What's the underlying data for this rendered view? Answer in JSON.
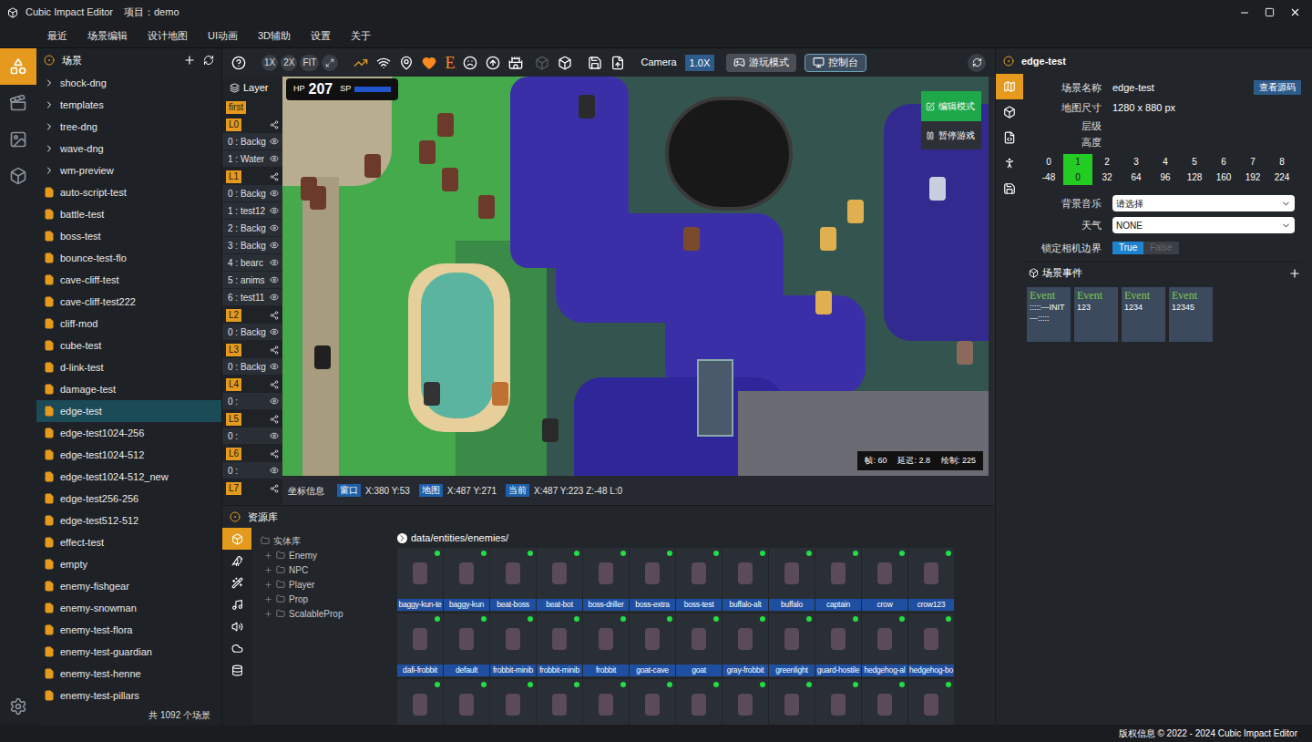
{
  "window": {
    "title": "Cubic Impact Editor",
    "project": "项目：demo"
  },
  "menu": [
    "最近",
    "场景编辑",
    "设计地图",
    "UI动画",
    "3D辅助",
    "设置",
    "关于"
  ],
  "rail": [
    {
      "selected": true
    },
    {
      "selected": false
    },
    {
      "selected": false
    },
    {
      "selected": false
    }
  ],
  "scenes": {
    "title": "场景",
    "footer": "共 1092 个场景",
    "items": [
      {
        "name": "shock-dng",
        "kind": "folder",
        "selected": false
      },
      {
        "name": "templates",
        "kind": "folder",
        "selected": false
      },
      {
        "name": "tree-dng",
        "kind": "folder",
        "selected": false
      },
      {
        "name": "wave-dng",
        "kind": "folder",
        "selected": false
      },
      {
        "name": "wm-preview",
        "kind": "folder",
        "selected": false
      },
      {
        "name": "auto-script-test",
        "kind": "file",
        "selected": false
      },
      {
        "name": "battle-test",
        "kind": "file",
        "selected": false
      },
      {
        "name": "boss-test",
        "kind": "file",
        "selected": false
      },
      {
        "name": "bounce-test-flo",
        "kind": "file",
        "selected": false
      },
      {
        "name": "cave-cliff-test",
        "kind": "file",
        "selected": false
      },
      {
        "name": "cave-cliff-test222",
        "kind": "file",
        "selected": false
      },
      {
        "name": "cliff-mod",
        "kind": "file",
        "selected": false
      },
      {
        "name": "cube-test",
        "kind": "file",
        "selected": false
      },
      {
        "name": "d-link-test",
        "kind": "file",
        "selected": false
      },
      {
        "name": "damage-test",
        "kind": "file",
        "selected": false
      },
      {
        "name": "edge-test",
        "kind": "file",
        "selected": true
      },
      {
        "name": "edge-test1024-256",
        "kind": "file",
        "selected": false
      },
      {
        "name": "edge-test1024-512",
        "kind": "file",
        "selected": false
      },
      {
        "name": "edge-test1024-512_new",
        "kind": "file",
        "selected": false
      },
      {
        "name": "edge-test256-256",
        "kind": "file",
        "selected": false
      },
      {
        "name": "edge-test512-512",
        "kind": "file",
        "selected": false
      },
      {
        "name": "effect-test",
        "kind": "file",
        "selected": false
      },
      {
        "name": "empty",
        "kind": "file",
        "selected": false
      },
      {
        "name": "enemy-fishgear",
        "kind": "file",
        "selected": false
      },
      {
        "name": "enemy-snowman",
        "kind": "file",
        "selected": false
      },
      {
        "name": "enemy-test-flora",
        "kind": "file",
        "selected": false
      },
      {
        "name": "enemy-test-guardian",
        "kind": "file",
        "selected": false
      },
      {
        "name": "enemy-test-henne",
        "kind": "file",
        "selected": false
      },
      {
        "name": "enemy-test-pillars",
        "kind": "file",
        "selected": false
      }
    ]
  },
  "toolbar": {
    "zoom": [
      "1X",
      "2X",
      "FIT"
    ],
    "e_label": "E",
    "camera_label": "Camera",
    "camera_value": "1.0X",
    "play_mode": "游玩模式",
    "console": "控制台"
  },
  "layers": {
    "title": "Layer",
    "groups": [
      {
        "label": "first",
        "kind": "marker",
        "rows": []
      },
      {
        "label": "L0",
        "kind": "layer",
        "rows": [
          "0 : Backg",
          "1 : Water"
        ]
      },
      {
        "label": "L1",
        "kind": "layer",
        "rows": [
          "0 : Backg",
          "1 : test12",
          "2 : Backg",
          "3 : Backg",
          "4 : bearc",
          "5 : anims",
          "6 : test11"
        ]
      },
      {
        "label": "L2",
        "kind": "layer",
        "rows": [
          "0 : Backg"
        ]
      },
      {
        "label": "L3",
        "kind": "layer",
        "rows": [
          "0 : Backg"
        ]
      },
      {
        "label": "L4",
        "kind": "layer",
        "rows": [
          "0 : "
        ]
      },
      {
        "label": "L5",
        "kind": "layer",
        "rows": [
          "0 : "
        ]
      },
      {
        "label": "L6",
        "kind": "layer",
        "rows": [
          "0 : "
        ]
      },
      {
        "label": "L7",
        "kind": "layer",
        "rows": []
      }
    ]
  },
  "game": {
    "hp_label": "HP",
    "hp": "207",
    "sp_label": "SP",
    "edit_mode": "编辑模式",
    "pause": "暂停游戏",
    "stats": [
      "帧: 60",
      "延迟: 2.8",
      "绘制: 225"
    ]
  },
  "coords": {
    "title": "坐标信息",
    "items": [
      {
        "tag": "窗口",
        "value": "X:380 Y:53"
      },
      {
        "tag": "地图",
        "value": "X:487 Y:271"
      },
      {
        "tag": "当前",
        "value": "X:487 Y:223 Z:-48 L:0"
      }
    ]
  },
  "resources": {
    "title": "资源库",
    "tabs": [
      {
        "selected": true
      },
      {
        "selected": false
      },
      {
        "selected": false
      },
      {
        "selected": false
      },
      {
        "selected": false
      },
      {
        "selected": false
      },
      {
        "selected": false
      }
    ],
    "tree": {
      "root": "实体库",
      "children": [
        "Enemy",
        "NPC",
        "Player",
        "Prop",
        "ScalableProp"
      ]
    },
    "path": "data/entities/enemies/",
    "entities": [
      {
        "name": "baggy-kun-te"
      },
      {
        "name": "baggy-kun"
      },
      {
        "name": "beat-boss"
      },
      {
        "name": "beat-bot"
      },
      {
        "name": "boss-driller"
      },
      {
        "name": "boss-extra"
      },
      {
        "name": "boss-test"
      },
      {
        "name": "buffalo-alt"
      },
      {
        "name": "buffalo"
      },
      {
        "name": "captain"
      },
      {
        "name": "crow"
      },
      {
        "name": "crow123"
      },
      {
        "name": "dafi-frobbit"
      },
      {
        "name": "default"
      },
      {
        "name": "frobbit-minib"
      },
      {
        "name": "frobbit-minib"
      },
      {
        "name": "frobbit"
      },
      {
        "name": "goat-cave"
      },
      {
        "name": "goat"
      },
      {
        "name": "gray-frobbit"
      },
      {
        "name": "greenlight"
      },
      {
        "name": "guard-hostile"
      },
      {
        "name": "hedgehog-al"
      },
      {
        "name": "hedgehog-bo"
      },
      {
        "name": ""
      },
      {
        "name": ""
      },
      {
        "name": ""
      },
      {
        "name": ""
      },
      {
        "name": ""
      },
      {
        "name": ""
      },
      {
        "name": ""
      },
      {
        "name": ""
      },
      {
        "name": ""
      },
      {
        "name": ""
      },
      {
        "name": ""
      },
      {
        "name": ""
      }
    ]
  },
  "right": {
    "title": "edge-test",
    "tabs": [
      {
        "selected": true
      },
      {
        "selected": false
      },
      {
        "selected": false
      },
      {
        "selected": false
      },
      {
        "selected": false
      }
    ],
    "scene_name_label": "场景名称",
    "scene_name": "edge-test",
    "view_source": "查看源码",
    "map_size_label": "地图尺寸",
    "map_size": "1280 x 880 px",
    "level_label": "层级",
    "height_label": "高度",
    "levels": [
      {
        "level": "0",
        "height": "-48",
        "selected": false
      },
      {
        "level": "1",
        "height": "0",
        "selected": true
      },
      {
        "level": "2",
        "height": "32",
        "selected": false
      },
      {
        "level": "3",
        "height": "64",
        "selected": false
      },
      {
        "level": "4",
        "height": "96",
        "selected": false
      },
      {
        "level": "5",
        "height": "128",
        "selected": false
      },
      {
        "level": "6",
        "height": "160",
        "selected": false
      },
      {
        "level": "7",
        "height": "192",
        "selected": false
      },
      {
        "level": "8",
        "height": "224",
        "selected": false
      }
    ],
    "bgm_label": "背景音乐",
    "bgm": "请选择",
    "weather_label": "天气",
    "weather": "NONE",
    "lock_label": "锁定相机边界",
    "lock_options": [
      {
        "label": "True",
        "selected": true
      },
      {
        "label": "False",
        "selected": false
      }
    ],
    "events_title": "场景事件",
    "events": [
      {
        "title": "Event",
        "name": ":::::—INIT—:::::"
      },
      {
        "title": "Event",
        "name": "123"
      },
      {
        "title": "Event",
        "name": "1234"
      },
      {
        "title": "Event",
        "name": "12345"
      }
    ]
  },
  "status_bar": "版权信息 © 2022 - 2024 Cubic Impact Editor"
}
